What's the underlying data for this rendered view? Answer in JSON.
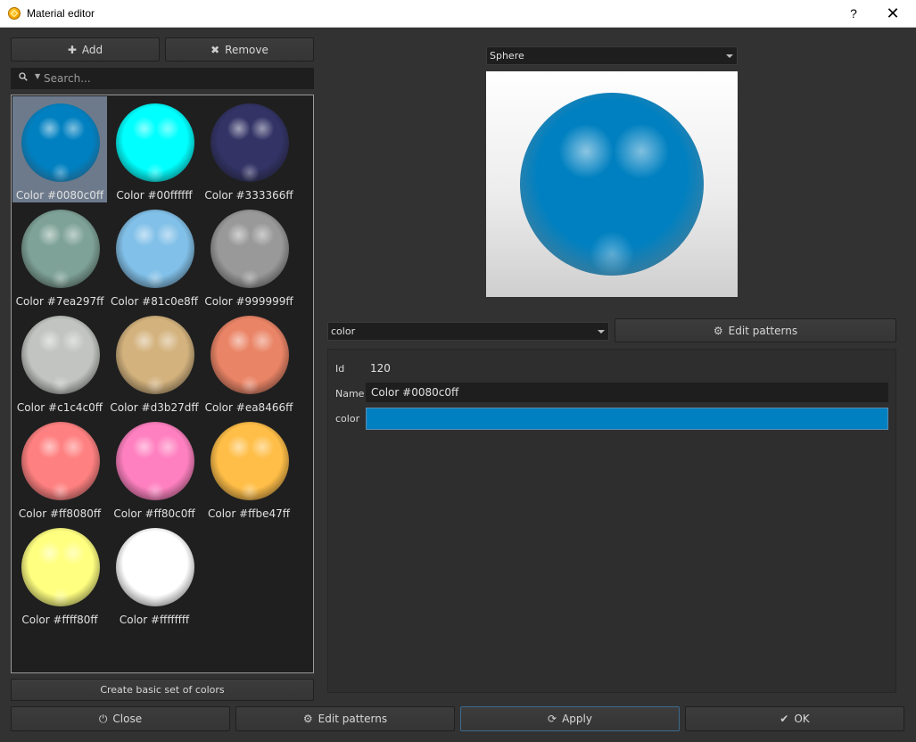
{
  "window": {
    "title": "Material editor",
    "help": "?",
    "close": "✕"
  },
  "toolbar": {
    "add_label": "Add",
    "remove_label": "Remove"
  },
  "search": {
    "placeholder": "Search..."
  },
  "materials": [
    {
      "label": "Color #0080c0ff",
      "color": "#0080c0",
      "selected": true
    },
    {
      "label": "Color #00ffffff",
      "color": "#00ffff",
      "selected": false
    },
    {
      "label": "Color #333366ff",
      "color": "#333366",
      "selected": false
    },
    {
      "label": "Color #7ea297ff",
      "color": "#7ea297",
      "selected": false
    },
    {
      "label": "Color #81c0e8ff",
      "color": "#81c0e8",
      "selected": false
    },
    {
      "label": "Color #999999ff",
      "color": "#999999",
      "selected": false
    },
    {
      "label": "Color #c1c4c0ff",
      "color": "#c1c4c0",
      "selected": false
    },
    {
      "label": "Color #d3b27dff",
      "color": "#d3b27d",
      "selected": false
    },
    {
      "label": "Color #ea8466ff",
      "color": "#ea8466",
      "selected": false
    },
    {
      "label": "Color #ff8080ff",
      "color": "#ff8080",
      "selected": false
    },
    {
      "label": "Color #ff80c0ff",
      "color": "#ff80c0",
      "selected": false
    },
    {
      "label": "Color #ffbe47ff",
      "color": "#ffbe47",
      "selected": false
    },
    {
      "label": "Color #ffff80ff",
      "color": "#ffff80",
      "selected": false
    },
    {
      "label": "Color #ffffffff",
      "color": "#ffffff",
      "selected": false
    }
  ],
  "create_basic_label": "Create basic set of colors",
  "preview": {
    "shape": "Sphere",
    "color": "#0080c0"
  },
  "pattern": {
    "selected": "color",
    "edit_patterns_label": "Edit patterns"
  },
  "properties": {
    "id_label": "Id",
    "id_value": "120",
    "name_label": "Name",
    "name_value": "Color #0080c0ff",
    "color_label": "color",
    "color_value": "#0080c0"
  },
  "footer": {
    "close": "Close",
    "edit_patterns": "Edit patterns",
    "apply": "Apply",
    "ok": "OK"
  }
}
